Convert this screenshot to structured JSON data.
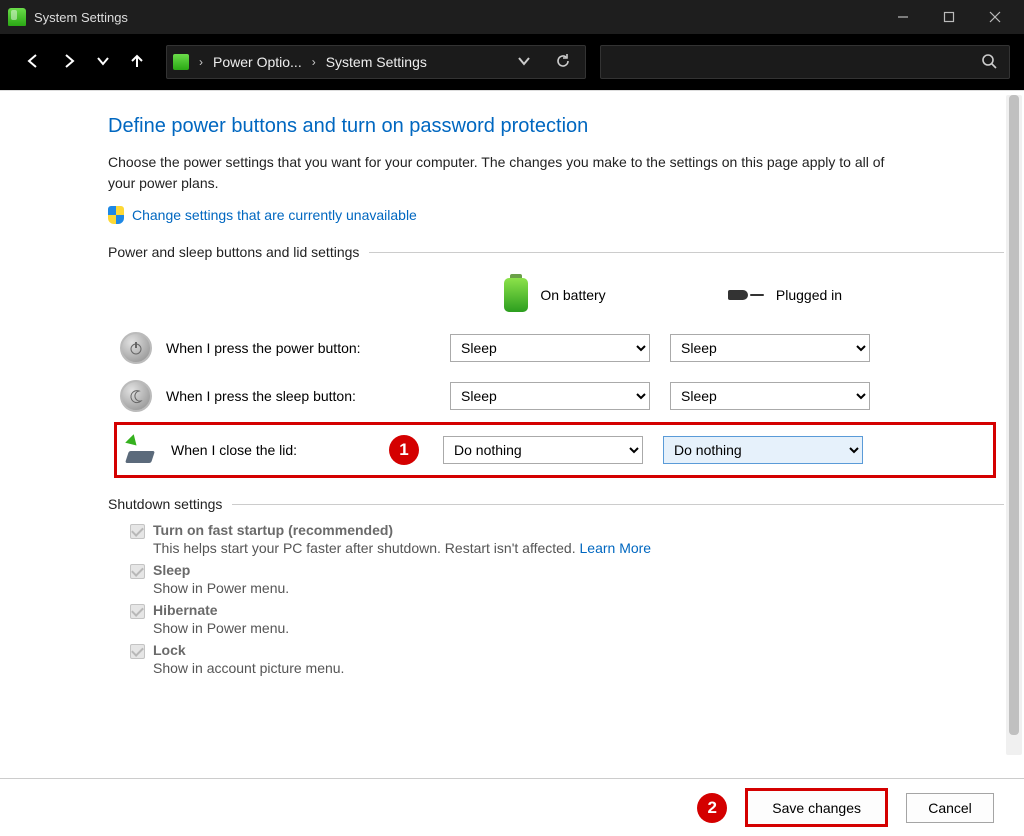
{
  "titlebar": {
    "title": "System Settings"
  },
  "nav": {
    "breadcrumb1": "Power Optio...",
    "breadcrumb2": "System Settings"
  },
  "page": {
    "heading": "Define power buttons and turn on password protection",
    "description": "Choose the power settings that you want for your computer. The changes you make to the settings on this page apply to all of your power plans.",
    "change_settings_link": "Change settings that are currently unavailable",
    "section1_title": "Power and sleep buttons and lid settings",
    "col_battery": "On battery",
    "col_plugged": "Plugged in",
    "rows": {
      "power_btn_label": "When I press the power button:",
      "power_btn_batt": "Sleep",
      "power_btn_plug": "Sleep",
      "sleep_btn_label": "When I press the sleep button:",
      "sleep_btn_batt": "Sleep",
      "sleep_btn_plug": "Sleep",
      "lid_label": "When I close the lid:",
      "lid_batt": "Do nothing",
      "lid_plug": "Do nothing"
    },
    "section2_title": "Shutdown settings",
    "shutdown": {
      "fast_startup_label": "Turn on fast startup (recommended)",
      "fast_startup_desc": "This helps start your PC faster after shutdown. Restart isn't affected. ",
      "fast_startup_link": "Learn More",
      "sleep_label": "Sleep",
      "sleep_desc": "Show in Power menu.",
      "hibernate_label": "Hibernate",
      "hibernate_desc": "Show in Power menu.",
      "lock_label": "Lock",
      "lock_desc": "Show in account picture menu."
    }
  },
  "annotations": {
    "badge1": "1",
    "badge2": "2"
  },
  "footer": {
    "save": "Save changes",
    "cancel": "Cancel"
  }
}
